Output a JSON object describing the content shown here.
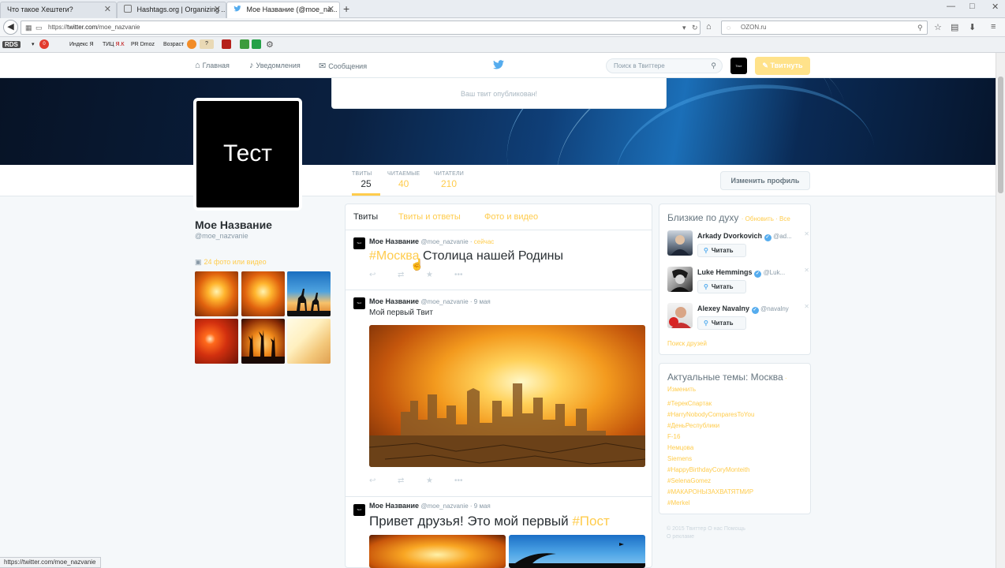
{
  "browser": {
    "tabs": [
      {
        "label": "Что такое Хештеги?"
      },
      {
        "label": "Hashtags.org | Organizing ..."
      },
      {
        "label": "Мое Название (@moe_na..."
      }
    ],
    "new_tab": "+",
    "url_prefix": "https://",
    "url_domain": "twitter.com",
    "url_path": "/moe_nazvanie",
    "search_text": "OZON.ru",
    "status_url": "https://twitter.com/moe_nazvanie"
  },
  "bookmarks": {
    "rds": "RDS",
    "yandex": "Индекс Я",
    "tic": "ТИЦ",
    "tic_sub": "Я.К",
    "pr": "PR",
    "dmoz": "Dmoz",
    "age": "Возраст",
    "counter": "0",
    "q": "?"
  },
  "twitter": {
    "nav": {
      "home": "Главная",
      "notifications": "Уведомления",
      "messages": "Сообщения"
    },
    "search_placeholder": "Поиск в Твиттере",
    "avatar_small": "Тест",
    "tweet_button": "Твитнуть",
    "notice": "Ваш твит опубликован!",
    "stats": [
      {
        "label": "ТВИТЫ",
        "value": "25"
      },
      {
        "label": "ЧИТАЕМЫЕ",
        "value": "40"
      },
      {
        "label": "ЧИТАТЕЛИ",
        "value": "210"
      }
    ],
    "edit_profile": "Изменить профиль",
    "avatar_text": "Тест"
  },
  "profile": {
    "name": "Мое Название",
    "handle": "@moe_nazvanie",
    "photos_link": "24 фото или видео"
  },
  "timeline": {
    "tabs": [
      "Твиты",
      "Твиты и ответы",
      "Фото и видео"
    ],
    "tweets": [
      {
        "name": "Мое Название",
        "handle": "@moe_nazvanie",
        "time": "сейчас",
        "hashtag": "#Москва",
        "text": " Столица нашей Родины"
      },
      {
        "name": "Мое Название",
        "handle": "@moe_nazvanie",
        "time": "9 мая",
        "text": "Мой первый Твит"
      },
      {
        "name": "Мое Название",
        "handle": "@moe_nazvanie",
        "time": "9 мая",
        "text": "Привет друзья! Это мой первый ",
        "hashtag": "#Пост"
      }
    ],
    "avatar_text": "Тест"
  },
  "who_to_follow": {
    "title": "Близкие по духу",
    "refresh": "Обновить",
    "all": "Все",
    "follow_label": "Читать",
    "accounts": [
      {
        "name": "Arkady Dvorkovich",
        "handle": "@ad..."
      },
      {
        "name": "Luke Hemmings",
        "handle": "@Luk..."
      },
      {
        "name": "Alexey Navalny",
        "handle": "@navalny"
      }
    ],
    "find_friends": "Поиск друзей"
  },
  "trends": {
    "title": "Актуальные темы: Москва",
    "change": "Изменить",
    "items": [
      "#ТерекСпартак",
      "#HarryNobodyComparesToYou",
      "#ДеньРеспублики",
      "F-16",
      "Немцова",
      "Siemens",
      "#HappyBirthdayCoryMonteith",
      "#SelenaGomez",
      "#МАКАРОНЫЗАХВАТЯТМИР",
      "#Merkel"
    ]
  },
  "footer": {
    "line1": "© 2015 Твиттер   О нас   Помощь",
    "line2": "О рекламе"
  },
  "colors": {
    "accent": "#ffcc4d",
    "twitter_blue": "#55acee",
    "text": "#292f33",
    "muted": "#8899a6"
  }
}
